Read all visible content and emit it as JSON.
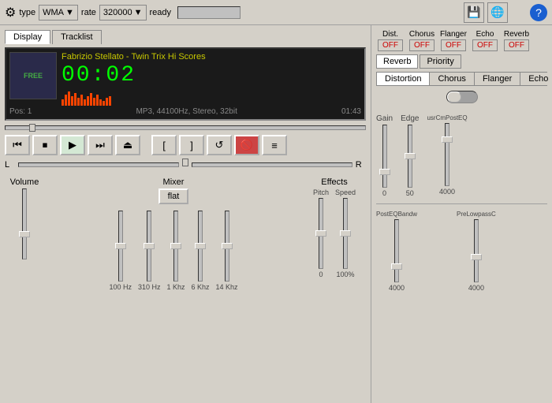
{
  "toolbar": {
    "type_label": "type",
    "format_label": "WMA",
    "rate_label": "rate",
    "bitrate_value": "320000",
    "ready_label": "ready",
    "save_icon": "💾",
    "globe_icon": "🌐",
    "help_icon": "❓",
    "settings_icon": "⚙"
  },
  "tabs": {
    "display_label": "Display",
    "tracklist_label": "Tracklist"
  },
  "player": {
    "track_title": "Fabrizio Stellato - Twin Trix Hi Scores",
    "time_display": "00:02",
    "pos_label": "Pos: 1",
    "format_info": "MP3, 44100Hz, Stereo, 32bit",
    "duration": "01:43",
    "album_art_text": "FREE"
  },
  "transport": {
    "prev_icon": "⏮",
    "stop_icon": "⏹",
    "play_icon": "▶",
    "next_icon": "⏭",
    "eject_icon": "⏏",
    "btn1_icon": "▢",
    "btn2_icon": "▢",
    "repeat_icon": "🔁",
    "mute_icon": "🔇",
    "menu_icon": "≡"
  },
  "pan": {
    "l_label": "L",
    "r_label": "R"
  },
  "volume": {
    "label": "Volume"
  },
  "mixer": {
    "label": "Mixer",
    "flat_btn": "flat",
    "bands": [
      "100 Hz",
      "310 Hz",
      "1 Khz",
      "6 Khz",
      "14 Khz"
    ]
  },
  "effects": {
    "label": "Effects",
    "pitch_label": "Pitch",
    "speed_label": "Speed",
    "pitch_value": "0",
    "speed_value": "100%"
  },
  "fx_panel": {
    "dist_label": "Dist.",
    "chorus_label": "Chorus",
    "flanger_label": "Flanger",
    "echo_label": "Echo",
    "reverb_label": "Reverb",
    "dist_btn": "OFF",
    "chorus_btn": "OFF",
    "flanger_btn": "OFF",
    "echo_btn": "OFF",
    "reverb_btn": "OFF",
    "reverb_tab": "Reverb",
    "priority_tab": "Priority",
    "distortion_tab": "Distortion",
    "chorus_tab": "Chorus",
    "flanger_tab": "Flanger",
    "echo_tab": "Echo",
    "gain_label": "Gain",
    "edge_label": "Edge",
    "usrcm_label": "usrCmPostEQ",
    "post_label": "PostEQBandw",
    "pre_label": "PreLowpassC",
    "gain_val": "0",
    "edge_val": "50",
    "usrcm_val": "4000",
    "post_val": "4000",
    "pre_val": "4000"
  },
  "spectrum_bars": [
    8,
    14,
    18,
    12,
    16,
    10,
    14,
    8,
    12,
    16,
    10,
    14,
    8,
    6,
    10,
    12
  ]
}
